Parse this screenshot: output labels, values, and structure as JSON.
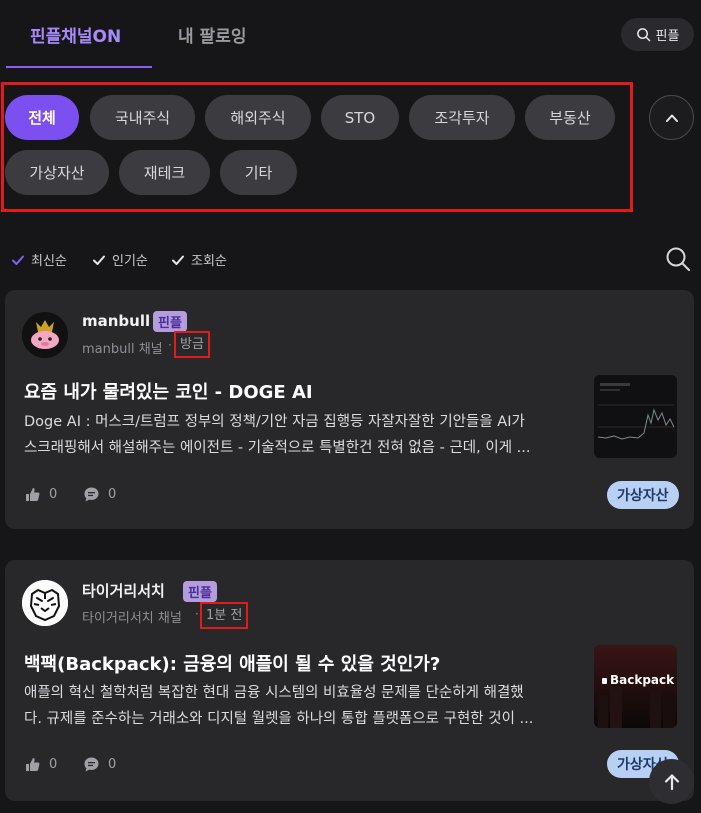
{
  "tabs": {
    "active": "핀플채널ON",
    "follow": "내 팔로잉"
  },
  "search": {
    "label": "핀플"
  },
  "categories": [
    "전체",
    "국내주식",
    "해외주식",
    "STO",
    "조각투자",
    "부동산",
    "가상자산",
    "재테크",
    "기타"
  ],
  "sort": [
    "최신순",
    "인기순",
    "조회순"
  ],
  "posts": [
    {
      "author": "manbull",
      "badge": "핀플",
      "channel": "manbull 채널",
      "time": "방금",
      "title": "요즘 내가 물려있는 코인 - DOGE AI",
      "excerpt_line1": "Doge AI : 머스크/트럼프 정부의 정책/기안 자금 집행등 자잘자잘한 기안들을 AI가",
      "excerpt_line2": "스크래핑해서 해설해주는 에이전트 - 기술적으로 특별한건 전혀 없음 - 근데, 이게 ...",
      "likes": "0",
      "comments": "0",
      "tag": "가상자산"
    },
    {
      "author": "타이거리서치",
      "badge": "핀플",
      "channel": "타이거리서치 채널",
      "time": "1분 전",
      "title": "백팩(Backpack): 금융의 애플이 될 수 있을 것인가?",
      "excerpt_line1": "애플의 혁신 철학처럼 복잡한 현대 금융 시스템의 비효율성 문제를 단순하게 해결했",
      "excerpt_line2": "다. 규제를 준수하는 거래소와 디지털 월렛을 하나의 통합 플랫폼으로 구현한 것이 ...",
      "likes": "0",
      "comments": "0",
      "tag": "가상자산",
      "thumb_text": "Backpack"
    }
  ],
  "colors": {
    "accent": "#7c4ff0",
    "highlight": "#e01b1b",
    "background": "#161618",
    "card": "#28282b"
  }
}
